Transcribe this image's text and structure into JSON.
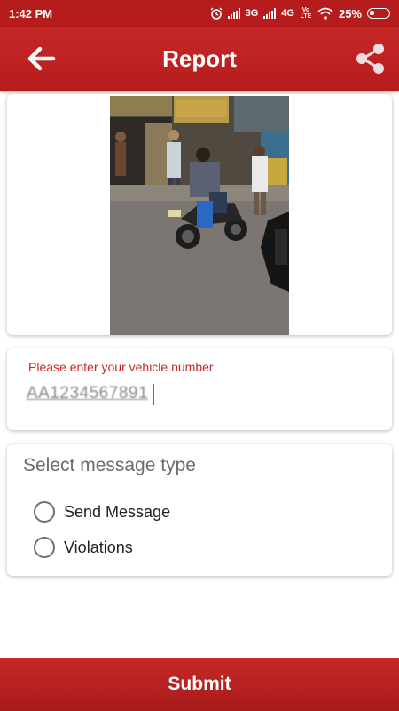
{
  "status_bar": {
    "time": "1:42 PM",
    "network_1": "3G",
    "network_2": "4G",
    "volte": "Vo LTE",
    "battery": "25%"
  },
  "app_bar": {
    "title": "Report",
    "back_icon": "arrow-left-icon",
    "share_icon": "share-icon"
  },
  "report_photo": {
    "description_icon": "photo"
  },
  "vehicle": {
    "label": "Please enter your vehicle number",
    "value": "AA1234567891"
  },
  "message_type": {
    "heading": "Select message type",
    "options": [
      {
        "label": "Send Message",
        "selected": false
      },
      {
        "label": "Violations",
        "selected": false
      }
    ]
  },
  "submit": {
    "label": "Submit"
  },
  "colors": {
    "primary": "#b71c1c",
    "accent": "#c62828"
  }
}
